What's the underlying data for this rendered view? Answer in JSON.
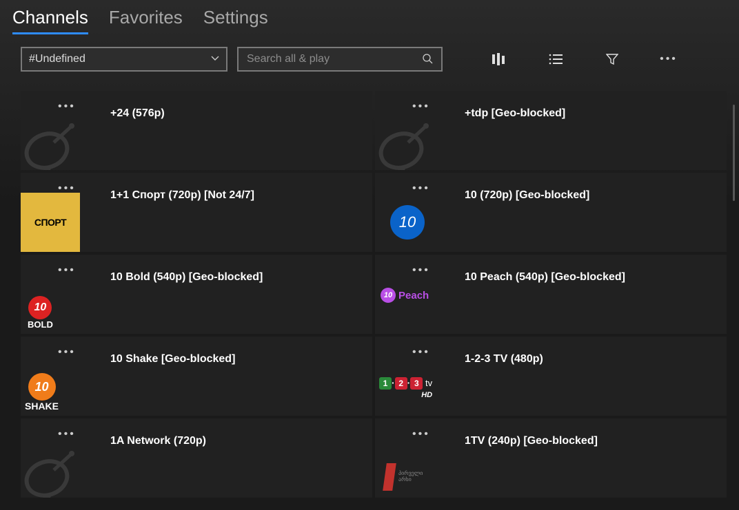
{
  "tabs": {
    "channels": "Channels",
    "favorites": "Favorites",
    "settings": "Settings"
  },
  "toolbar": {
    "dropdown_value": "#Undefined",
    "search_placeholder": "Search all & play"
  },
  "channels": [
    {
      "title": "+24 (576p)",
      "logo": "dish"
    },
    {
      "title": "+tdp [Geo-blocked]",
      "logo": "dish"
    },
    {
      "title": "1+1 Спорт (720p) [Not 24/7]",
      "logo": "sport",
      "logo_text": "СПОРТ"
    },
    {
      "title": "10 (720p) [Geo-blocked]",
      "logo": "ten",
      "logo_text": "10"
    },
    {
      "title": "10 Bold (540p) [Geo-blocked]",
      "logo": "bold",
      "logo_text": "10",
      "logo_sub": "BOLD"
    },
    {
      "title": "10 Peach (540p) [Geo-blocked]",
      "logo": "peach",
      "logo_text": "10",
      "logo_sub": "Peach"
    },
    {
      "title": "10 Shake [Geo-blocked]",
      "logo": "shake",
      "logo_text": "10",
      "logo_sub": "SHAKE"
    },
    {
      "title": "1-2-3 TV (480p)",
      "logo": "123tv",
      "logo_text": "1·2·3",
      "logo_sub": "tv HD"
    },
    {
      "title": "1A Network (720p)",
      "logo": "dish"
    },
    {
      "title": "1TV (240p) [Geo-blocked]",
      "logo": "1tv",
      "logo_text": "პირველი არხი"
    }
  ]
}
